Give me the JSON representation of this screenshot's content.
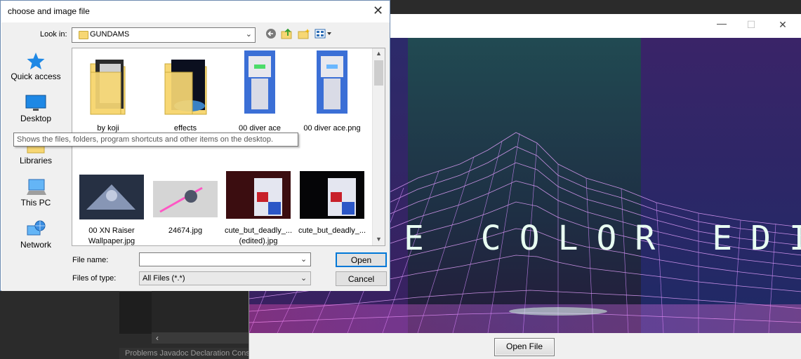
{
  "dialog": {
    "title": "choose and image file",
    "look_in_label": "Look in:",
    "look_in_value": "GUNDAMS",
    "places": [
      {
        "label": "Quick access",
        "icon": "quick-access-star-icon"
      },
      {
        "label": "Desktop",
        "icon": "desktop-icon"
      },
      {
        "label": "Libraries",
        "icon": "libraries-icon"
      },
      {
        "label": "This PC",
        "icon": "this-pc-icon"
      },
      {
        "label": "Network",
        "icon": "network-icon"
      }
    ],
    "files": [
      {
        "name": "by koji",
        "kind": "folder"
      },
      {
        "name": "effects",
        "kind": "folder"
      },
      {
        "name": "00 diver ace\n(edited).png",
        "kind": "image"
      },
      {
        "name": "00 diver ace.png",
        "kind": "image"
      },
      {
        "name": "00 XN Raiser\nWallpaper.jpg",
        "kind": "image"
      },
      {
        "name": "24674.jpg",
        "kind": "image"
      },
      {
        "name": "cute_but_deadly_...\n(edited).jpg",
        "kind": "image"
      },
      {
        "name": "cute_but_deadly_...",
        "kind": "image"
      }
    ],
    "file_name_label": "File name:",
    "file_name_value": "",
    "files_of_type_label": "Files of type:",
    "files_of_type_value": "All Files (*.*)",
    "open_label": "Open",
    "cancel_label": "Cancel",
    "tooltip": "Shows the files, folders, program shortcuts and other items on the desktop."
  },
  "app": {
    "banner_text": "E COLOR EDITOR",
    "open_file_label": "Open File"
  },
  "ide": {
    "tabs": "Problems   Javadoc   Declaration   Console"
  },
  "colors": {
    "accent": "#0078d7",
    "folder": "#f7d774",
    "banner_bg": "#1f3d47",
    "mesh": "#e7a0ff"
  }
}
